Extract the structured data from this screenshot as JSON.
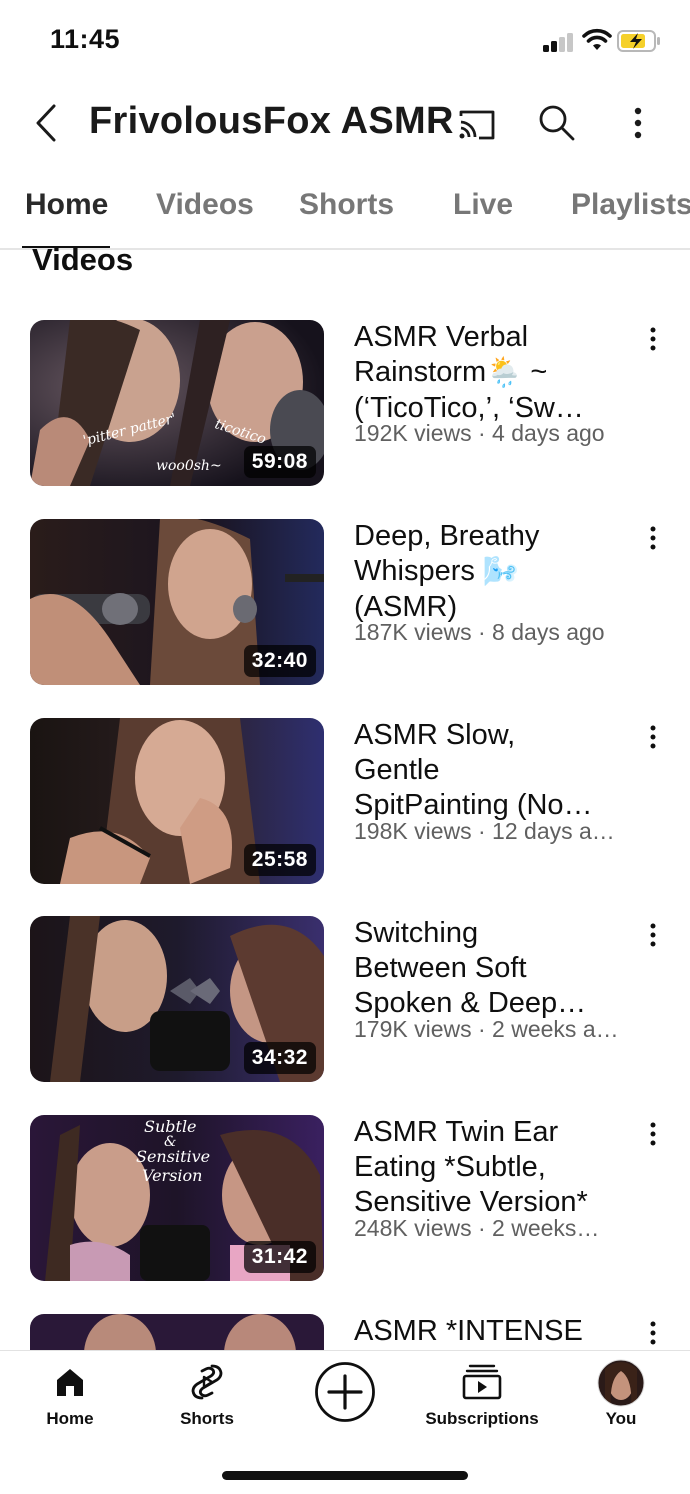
{
  "status_bar": {
    "time": "11:45"
  },
  "header": {
    "channel_name": "FrivolousFox ASMR",
    "icons": [
      "back-icon",
      "cast-icon",
      "search-icon",
      "more-vert-icon"
    ]
  },
  "tabs": [
    {
      "label": "Home",
      "active": true
    },
    {
      "label": "Videos",
      "active": false
    },
    {
      "label": "Shorts",
      "active": false
    },
    {
      "label": "Live",
      "active": false
    },
    {
      "label": "Playlists",
      "active": false
    }
  ],
  "section": {
    "title": "Videos"
  },
  "videos": [
    {
      "title_lines": [
        "ASMR Verbal",
        "Rainstorm",
        "(‘TicoTico,’, ‘Sw…"
      ],
      "title_emoji": "🌦️",
      "title_suffix": " ~",
      "meta": "192K views · 4 days ago",
      "duration": "59:08",
      "thumb_text": [
        "'pitter patter'",
        "ticotico",
        "woo0sh~"
      ]
    },
    {
      "title_lines": [
        "Deep, Breathy",
        "Whispers",
        "(ASMR)"
      ],
      "title_emoji": "🌬️",
      "meta": "187K views · 8 days ago",
      "duration": "32:40"
    },
    {
      "title_lines": [
        "ASMR Slow,",
        "Gentle",
        "SpitPainting (No…"
      ],
      "meta": "198K views · 12 days a…",
      "duration": "25:58"
    },
    {
      "title_lines": [
        "Switching",
        "Between Soft",
        "Spoken & Deep…"
      ],
      "meta": "179K views · 2 weeks a…",
      "duration": "34:32"
    },
    {
      "title_lines": [
        "ASMR Twin Ear",
        "Eating *Subtle,",
        "Sensitive Version*"
      ],
      "meta": "248K views · 2 weeks…",
      "duration": "31:42",
      "thumb_text": [
        "Subtle",
        "&",
        "Sensitive",
        "Version"
      ]
    },
    {
      "title_lines": [
        "ASMR *INTENSE"
      ],
      "meta": "",
      "duration": ""
    }
  ],
  "bottom_nav": [
    {
      "label": "Home",
      "icon": "home-icon",
      "active": true
    },
    {
      "label": "Shorts",
      "icon": "shorts-icon",
      "active": false
    },
    {
      "label": "",
      "icon": "create-plus-icon",
      "active": false
    },
    {
      "label": "Subscriptions",
      "icon": "subscriptions-icon",
      "active": false
    },
    {
      "label": "You",
      "icon": "avatar",
      "active": false
    }
  ],
  "colors": {
    "text_primary": "#0f0f0f",
    "text_secondary": "#606060",
    "tab_inactive": "#777777",
    "battery_charge": "#f5d02a"
  }
}
